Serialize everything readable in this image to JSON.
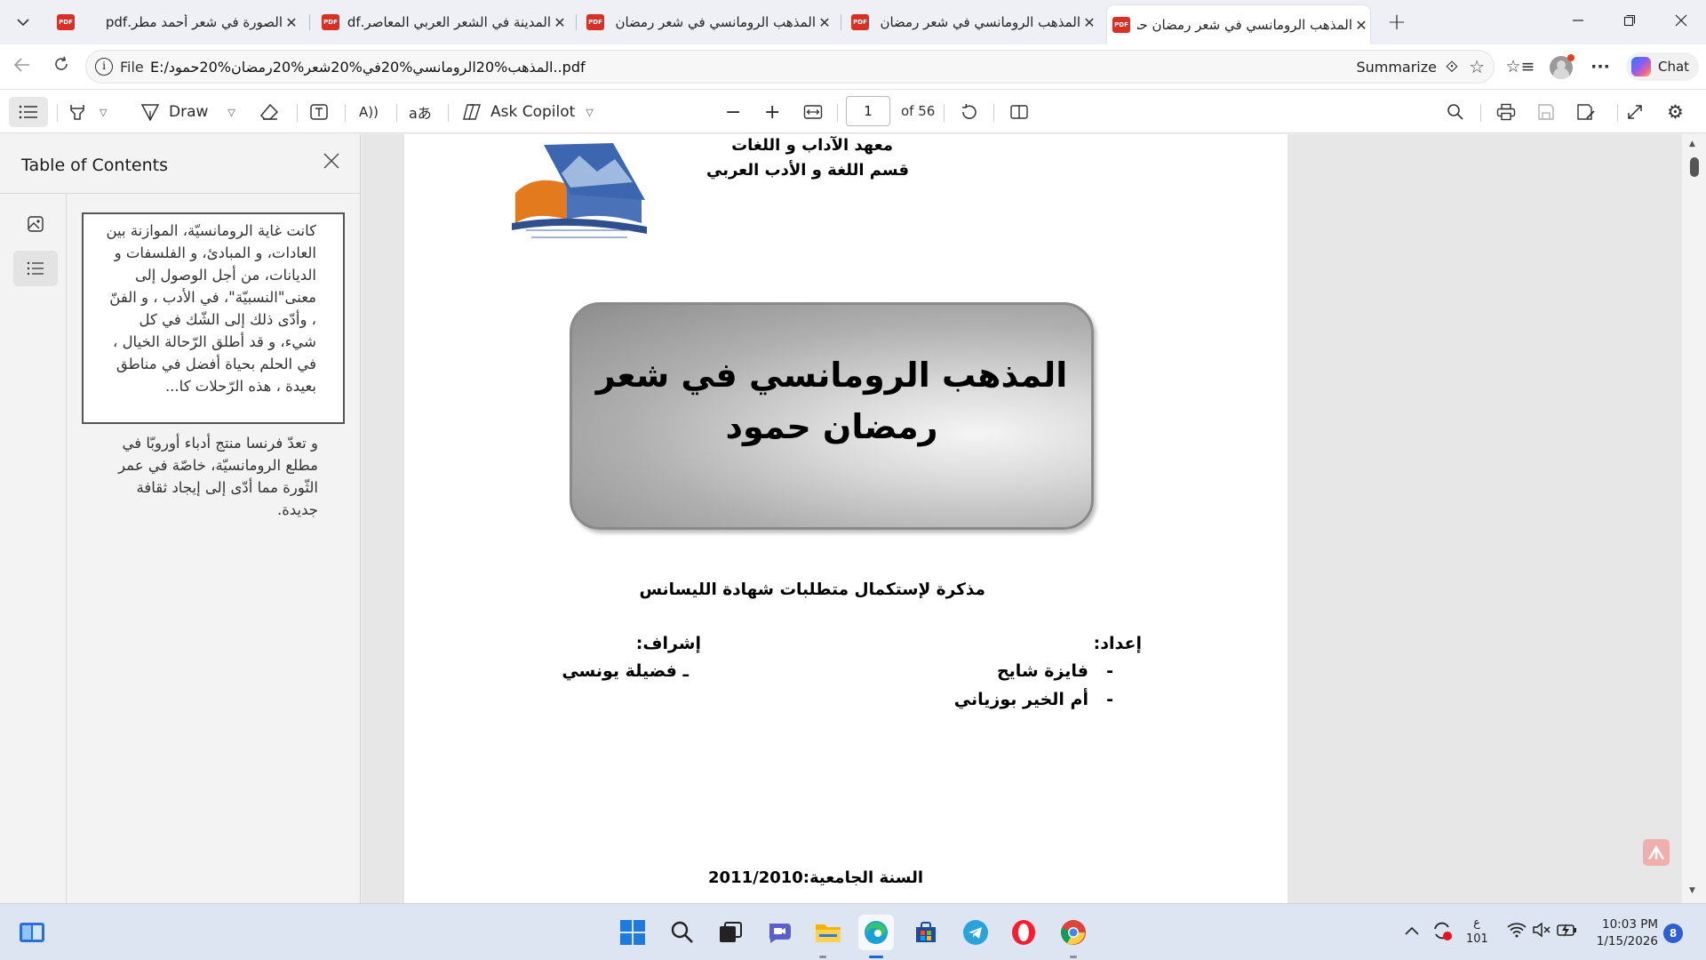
{
  "browser": {
    "tabs": [
      {
        "title": "الصورة في شعر أحمد مطر.pdf"
      },
      {
        "title": "المدينة في الشعر العربي المعاصر.pdf"
      },
      {
        "title": "المذهب الرومانسي في شعر رمضان حمود"
      },
      {
        "title": "المذهب الرومانسي في شعر رمضان حمود"
      },
      {
        "title": "المذهب الرومانسي في شعر رمضان حمود"
      }
    ],
    "active_tab_index": 4,
    "address": {
      "scheme_label": "File",
      "url": "E:/المذهب%20الرومانسي%20في%20شعر%20رمضان%20حمود..pdf"
    },
    "summarize_label": "Summarize",
    "chat_label": "Chat"
  },
  "pdf_toolbar": {
    "draw_label": "Draw",
    "ask_copilot_label": "Ask Copilot",
    "page_current": "1",
    "page_total_label": "of 56"
  },
  "sidebar": {
    "title": "Table of Contents",
    "toc_items": [
      {
        "text": "كانت غاية الرومانسيّة، الموازنة بين العادات، و المبادئ، و الفلسفات و الديانات، من أجل الوصول إلى معنى\"النسبيّة\"، في الأدب ، و الفنّ ، وأدّى ذلك إلى الشّك في كل شيء، و قد أطلق الرّحالة الخيال ، في الحلم بحياة أفضل في مناطق بعيدة ، هذه الرّحلات كا...",
        "selected": true
      },
      {
        "text": "و تعدّ فرنسا منتج أدباء أوروبّا في مطلع الرومانسيّة، خاصّة في عمر الثّورة مما أدّى إلى إيجاد ثقافة جديدة.",
        "selected": false
      }
    ]
  },
  "document": {
    "header_line1": "معهد الآداب و اللغات",
    "header_line2": "قسم اللغة و الأدب العربي",
    "title": "المذهب الرومانسي في شعر رمضان حمود",
    "subtitle": "مذكرة لإستكمال متطلبات شهادة الليسانس",
    "prepared_by_label": "إعداد:",
    "students": [
      "فايزة شايح",
      "أم الخير بوزياني"
    ],
    "supervision_label": "إشراف:",
    "supervisor": "ـ فضيلة يونسي",
    "dash": "-",
    "academic_year": "السنة الجامعية:2011/2010"
  },
  "taskbar": {
    "language_top": "ع",
    "language_bottom": "101",
    "time": "10:03 PM",
    "date": "1/15/2026",
    "notification_count": "8"
  }
}
